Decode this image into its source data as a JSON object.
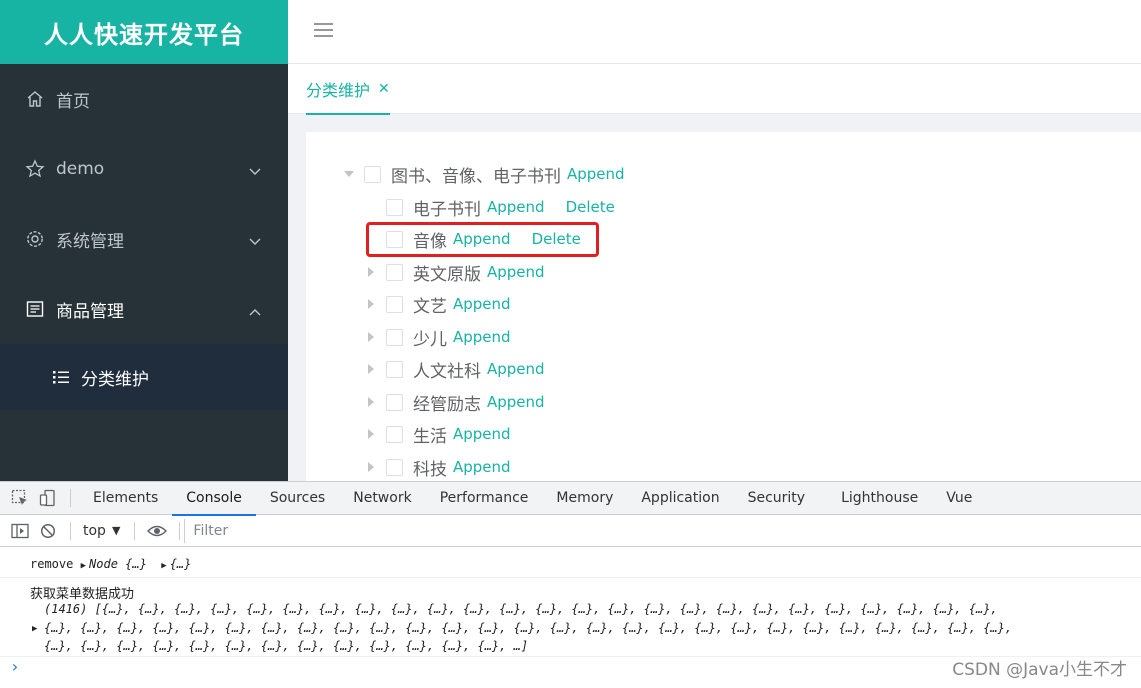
{
  "app": {
    "logo": "人人快速开发平台",
    "menu": [
      {
        "label": "首页",
        "icon": "home-icon"
      },
      {
        "label": "demo",
        "icon": "star-icon"
      },
      {
        "label": "系统管理",
        "icon": "gear-icon"
      },
      {
        "label": "商品管理",
        "icon": "document-icon"
      }
    ],
    "submenu": [
      {
        "label": "分类维护",
        "icon": "list-icon"
      }
    ],
    "tab": {
      "label": "分类维护",
      "close": "✕"
    },
    "tree": {
      "root": {
        "label": "图书、音像、电子书刊",
        "append": "Append"
      },
      "children": [
        {
          "label": "电子书刊",
          "append": "Append",
          "delete": "Delete",
          "expandable": false
        },
        {
          "label": "音像",
          "append": "Append",
          "delete": "Delete",
          "expandable": false
        },
        {
          "label": "英文原版",
          "append": "Append",
          "expandable": true
        },
        {
          "label": "文艺",
          "append": "Append",
          "expandable": true
        },
        {
          "label": "少儿",
          "append": "Append",
          "expandable": true
        },
        {
          "label": "人文社科",
          "append": "Append",
          "expandable": true
        },
        {
          "label": "经管励志",
          "append": "Append",
          "expandable": true
        },
        {
          "label": "生活",
          "append": "Append",
          "expandable": true
        },
        {
          "label": "科技",
          "append": "Append",
          "expandable": true
        }
      ]
    },
    "accent_color": "#17b3a3",
    "sidebar_color": "#263238",
    "highlight_color": "#e02020"
  },
  "devtools": {
    "tabs": [
      "Elements",
      "Console",
      "Sources",
      "Network",
      "Performance",
      "Memory",
      "Application",
      "Security",
      "Lighthouse",
      "Vue"
    ],
    "active_tab": "Console",
    "context": "top",
    "filter_placeholder": "Filter",
    "console": {
      "line1_text": "remove",
      "line1_obj1": "Node {…}",
      "line1_obj2": "{…}",
      "line2": "获取菜单数据成功",
      "line3": "(1416) [{…}, {…}, {…}, {…}, {…}, {…}, {…}, {…}, {…}, {…}, {…}, {…}, {…}, {…}, {…}, {…}, {…}, {…}, {…}, {…}, {…}, {…}, {…}, {…}, {…},",
      "line4": "{…}, {…}, {…}, {…}, {…}, {…}, {…}, {…}, {…}, {…}, {…}, {…}, {…}, {…}, {…}, {…}, {…}, {…}, {…}, {…}, {…}, {…}, {…}, {…}, {…}, {…}, {…},",
      "line5": "{…}, {…}, {…}, {…}, {…}, {…}, {…}, {…}, {…}, {…}, {…}, {…}, {…}, …]"
    },
    "watermark": "CSDN @Java小生不才"
  }
}
